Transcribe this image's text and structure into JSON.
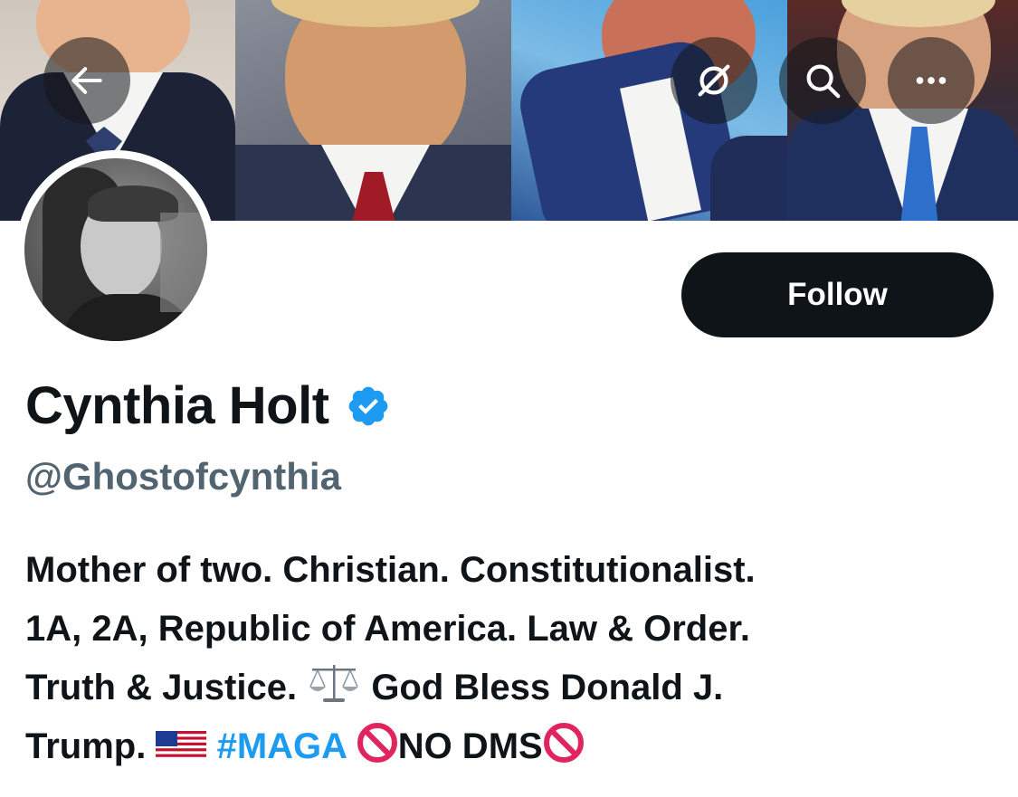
{
  "header": {
    "back_icon": "arrow-left-icon",
    "grok_icon": "grok-slash-circle-icon",
    "search_icon": "search-icon",
    "more_icon": "more-horizontal-icon"
  },
  "profile": {
    "follow_label": "Follow",
    "display_name": "Cynthia Holt",
    "verified": true,
    "handle": "@Ghostofcynthia",
    "bio": {
      "line1": "Mother of two. Christian. Constitutionalist.",
      "line2": "1A, 2A, Republic of America. Law & Order.",
      "line3_a": "Truth & Justice.",
      "line3_b": "God Bless Donald J.",
      "line4_a": "Trump.",
      "hashtag": "#MAGA",
      "no_dms": "NO DMS"
    }
  },
  "colors": {
    "text": "#0f1419",
    "secondary_text": "#536471",
    "link": "#1d9bf0",
    "button_bg": "#0f1419",
    "verified_badge": "#1d9bf0"
  }
}
